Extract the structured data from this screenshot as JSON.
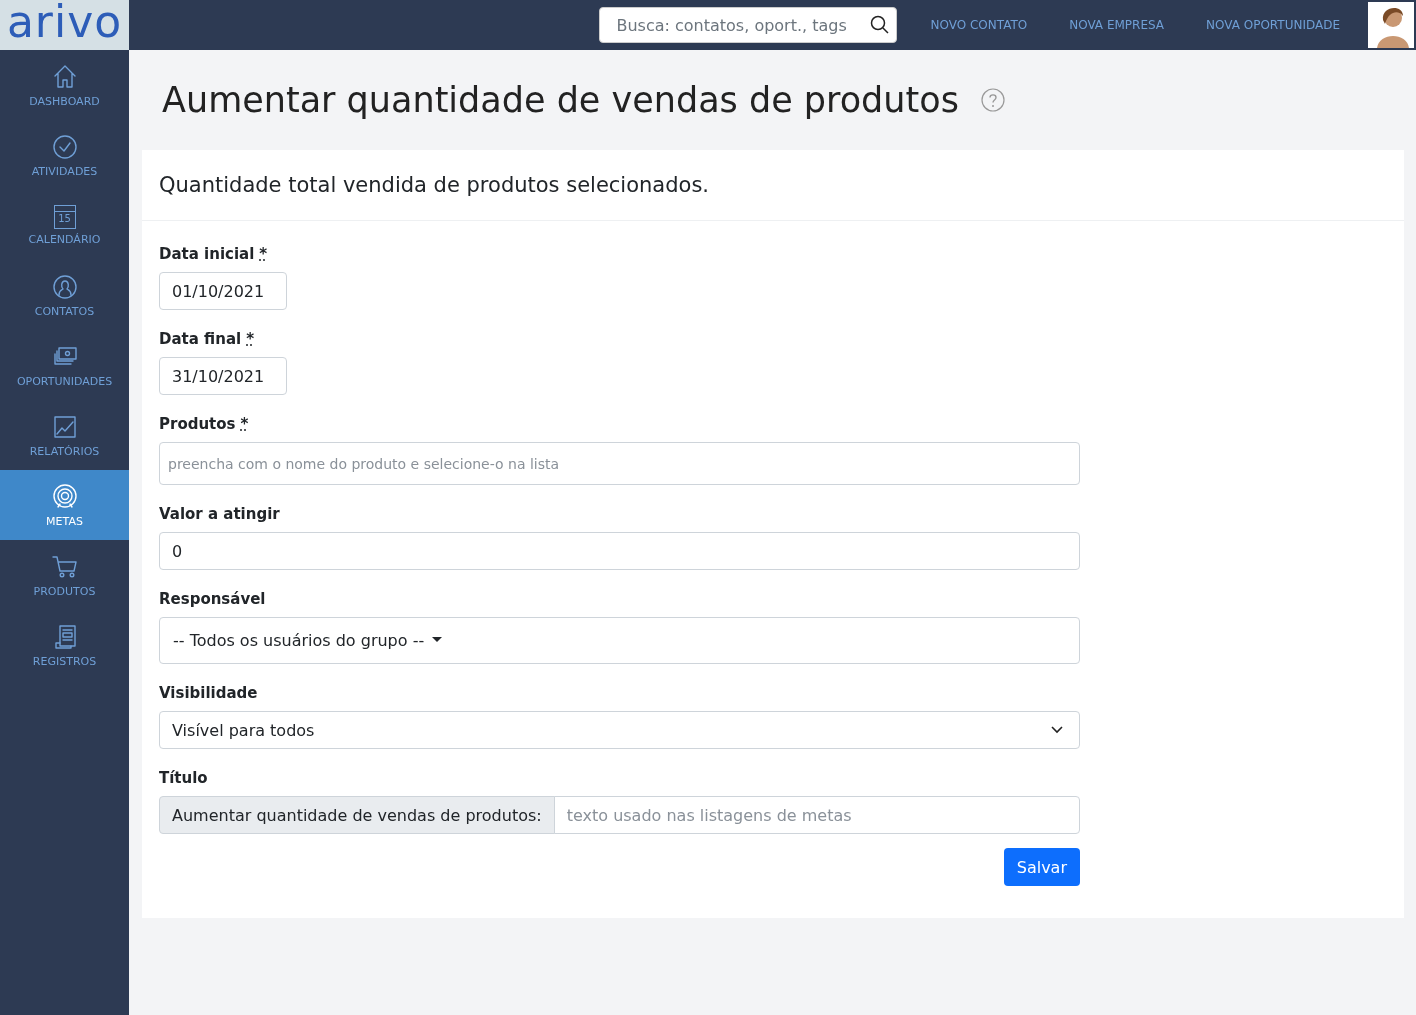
{
  "logo": "arivo",
  "search": {
    "placeholder": "Busca: contatos, oport., tags"
  },
  "top_links": [
    "NOVO CONTATO",
    "NOVA EMPRESA",
    "NOVA OPORTUNIDADE"
  ],
  "sidebar": {
    "items": [
      {
        "label": "DASHBOARD",
        "selected": false
      },
      {
        "label": "ATIVIDADES",
        "selected": false
      },
      {
        "label": "CALENDÁRIO",
        "selected": false
      },
      {
        "label": "CONTATOS",
        "selected": false
      },
      {
        "label": "OPORTUNIDADES",
        "selected": false
      },
      {
        "label": "RELATÓRIOS",
        "selected": false
      },
      {
        "label": "METAS",
        "selected": true
      },
      {
        "label": "PRODUTOS",
        "selected": false
      },
      {
        "label": "REGISTROS",
        "selected": false
      }
    ]
  },
  "calendar_day": "15",
  "page_title": "Aumentar quantidade de vendas de produtos",
  "card_title": "Quantidade total vendida de produtos selecionados.",
  "fields": [
    {
      "kind": "date",
      "label": "Data inicial",
      "required_mark": "*",
      "value": "01/10/2021"
    },
    {
      "kind": "date",
      "label": "Data final",
      "required_mark": "*",
      "value": "31/10/2021"
    },
    {
      "kind": "search",
      "label": "Produtos",
      "required_mark": "*",
      "placeholder": "preencha com o nome do produto e selecione-o na lista"
    },
    {
      "kind": "text",
      "label": "Valor a atingir",
      "value": "0"
    },
    {
      "kind": "dropdown",
      "label": "Responsável",
      "value": "-- Todos os usuários do grupo --"
    },
    {
      "kind": "select",
      "label": "Visibilidade",
      "value": "Visível para todos"
    },
    {
      "kind": "addon",
      "label": "Título",
      "prefix": "Aumentar quantidade de vendas de produtos:",
      "placeholder": "texto usado nas listagens de metas"
    }
  ],
  "save_button": "Salvar"
}
